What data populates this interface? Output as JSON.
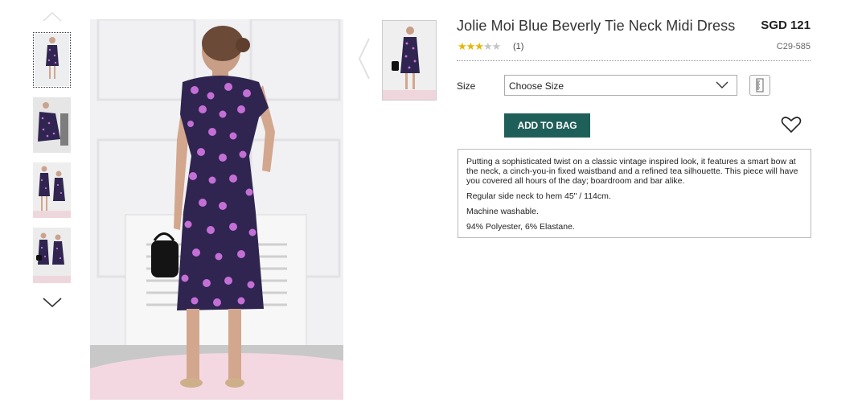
{
  "product": {
    "title": "Jolie Moi Blue Beverly Tie Neck Midi Dress",
    "price": "SGD 121",
    "rating_stars": "★★★",
    "rating_empty_stars": "★★",
    "rating_value": 3,
    "rating_max": 5,
    "review_count": "(1)",
    "sku": "C29-585"
  },
  "size": {
    "label": "Size",
    "selected": "Choose Size"
  },
  "actions": {
    "add_to_bag": "ADD TO BAG"
  },
  "description": {
    "paragraphs": [
      "Putting a sophisticated twist on a classic vintage inspired look, it features a smart bow at the neck, a cinch-you-in fixed waistband and a refined tea silhouette. This piece will have you covered all hours of the day; boardroom and bar alike.",
      "Regular side neck to hem 45\" / 114cm.",
      "Machine washable.",
      "94% Polyester, 6% Elastane."
    ]
  },
  "gallery": {
    "thumbnail_count": 4,
    "selected_index": 0
  },
  "colors": {
    "accent": "#1f5f5a",
    "dress": "#2f2550",
    "dots": "#c46fd6",
    "star": "#e8b500"
  }
}
